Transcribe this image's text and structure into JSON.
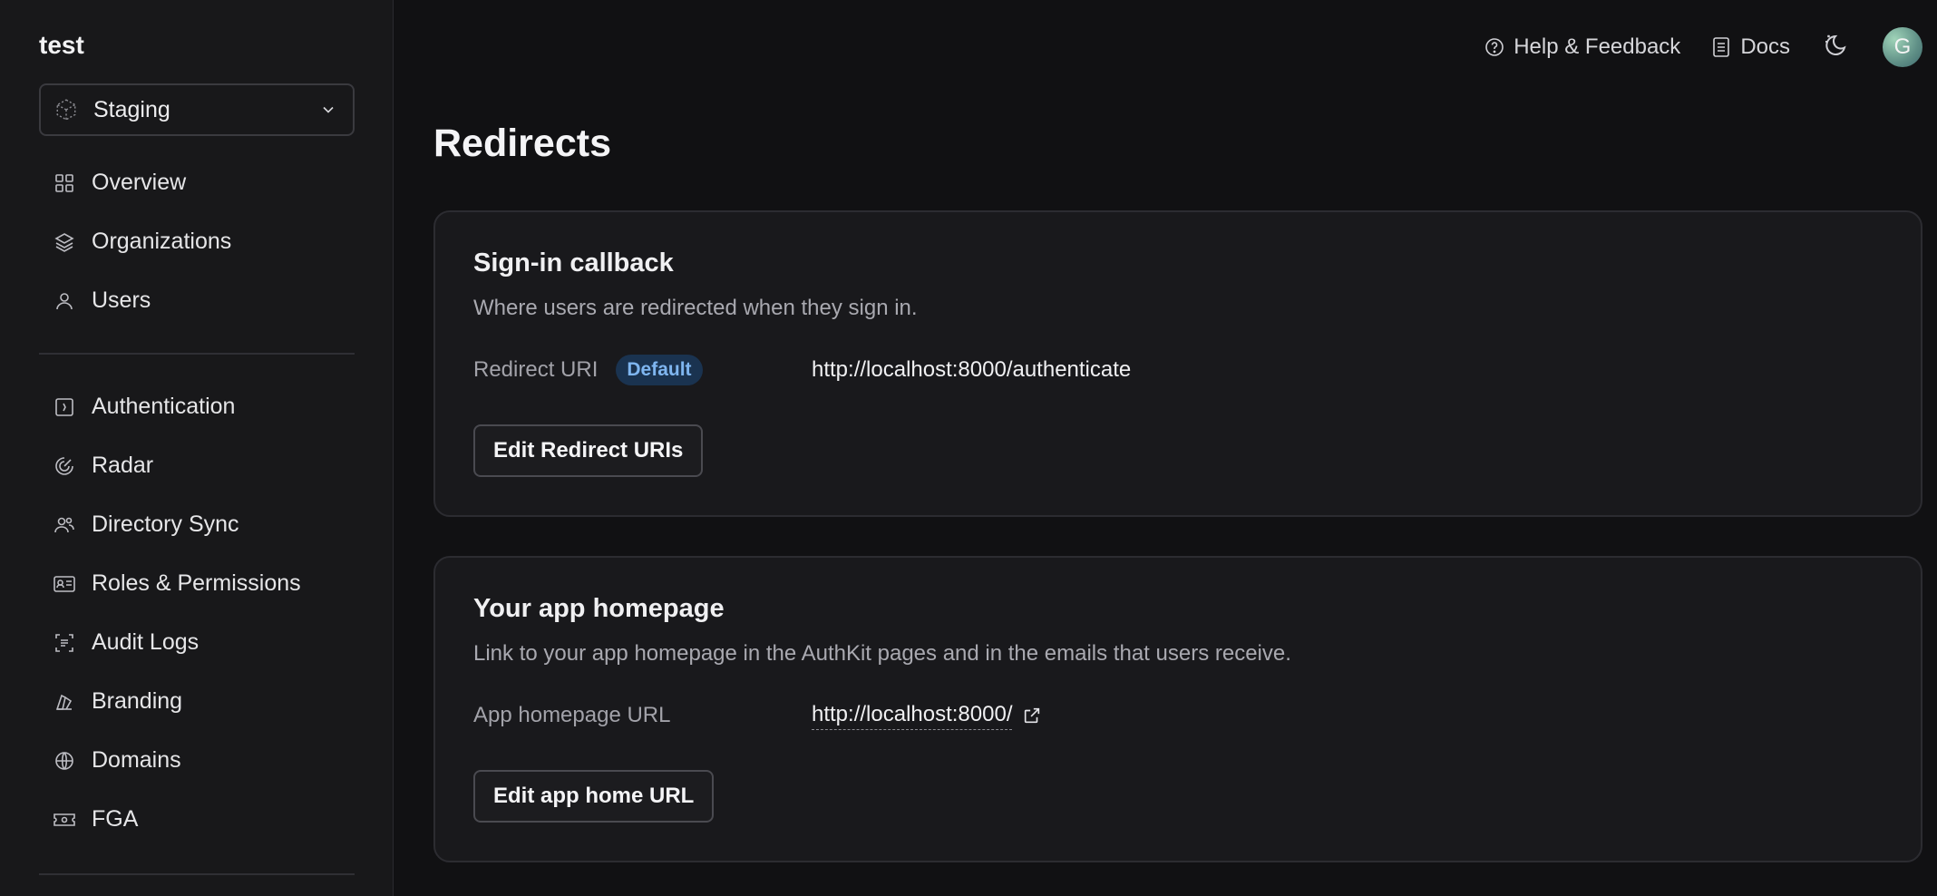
{
  "sidebar": {
    "org_name": "test",
    "environment": "Staging",
    "nav_primary": [
      {
        "label": "Overview",
        "icon": "grid-icon"
      },
      {
        "label": "Organizations",
        "icon": "layers-icon"
      },
      {
        "label": "Users",
        "icon": "user-icon"
      }
    ],
    "nav_secondary": [
      {
        "label": "Authentication",
        "icon": "auth-icon"
      },
      {
        "label": "Radar",
        "icon": "radar-icon"
      },
      {
        "label": "Directory Sync",
        "icon": "directory-sync-icon"
      },
      {
        "label": "Roles & Permissions",
        "icon": "id-card-icon"
      },
      {
        "label": "Audit Logs",
        "icon": "audit-logs-icon"
      },
      {
        "label": "Branding",
        "icon": "branding-icon"
      },
      {
        "label": "Domains",
        "icon": "globe-icon"
      },
      {
        "label": "FGA",
        "icon": "ticket-icon"
      }
    ]
  },
  "topbar": {
    "help_label": "Help & Feedback",
    "docs_label": "Docs",
    "avatar_initial": "G"
  },
  "page": {
    "title": "Redirects"
  },
  "signin_callback": {
    "title": "Sign-in callback",
    "description": "Where users are redirected when they sign in.",
    "field_label": "Redirect URI",
    "badge": "Default",
    "value": "http://localhost:8000/authenticate",
    "button_label": "Edit Redirect URIs"
  },
  "homepage": {
    "title": "Your app homepage",
    "description": "Link to your app homepage in the AuthKit pages and in the emails that users receive.",
    "field_label": "App homepage URL",
    "value": "http://localhost:8000/",
    "button_label": "Edit app home URL"
  },
  "colors": {
    "background": "#111113",
    "sidebar": "#18181a",
    "card": "#19191c",
    "badge_bg": "#1a3350",
    "badge_text": "#7fb6f0"
  }
}
